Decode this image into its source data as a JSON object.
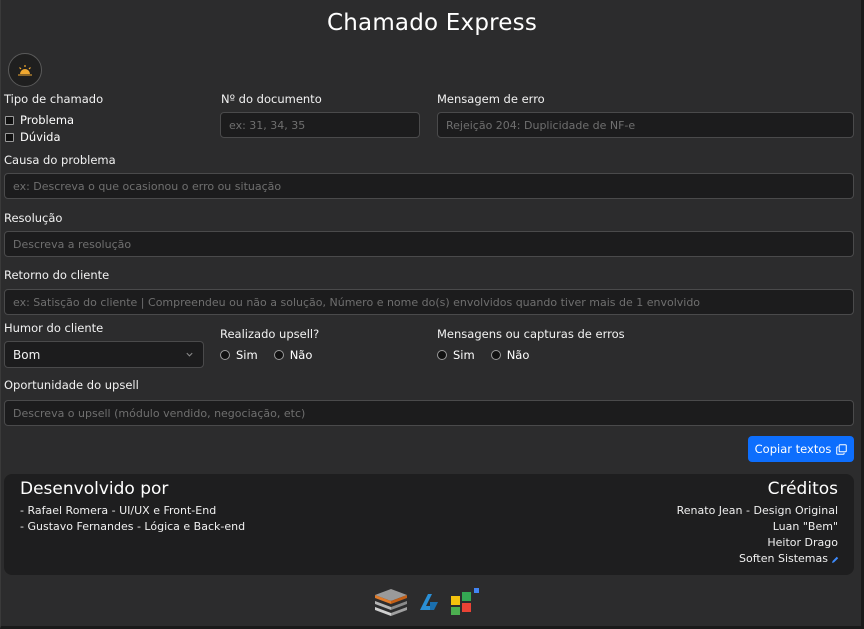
{
  "app": {
    "title": "Chamado Express"
  },
  "theme_toggle": {
    "icon": "sun-icon"
  },
  "tipo": {
    "label": "Tipo de chamado",
    "options": [
      "Problema",
      "Dúvida"
    ]
  },
  "documento": {
    "label": "Nº do documento",
    "placeholder": "ex: 31, 34, 35"
  },
  "erro": {
    "label": "Mensagem de erro",
    "placeholder": "Rejeição 204: Duplicidade de NF-e"
  },
  "causa": {
    "label": "Causa do problema",
    "placeholder": "ex: Descreva o que ocasionou o erro ou situação"
  },
  "resolucao": {
    "label": "Resolução",
    "placeholder": "Descreva a resolução"
  },
  "retorno": {
    "label": "Retorno do cliente",
    "placeholder": "ex: Satisção do cliente | Compreendeu ou não a solução, Número e nome do(s) envolvidos quando tiver mais de 1 envolvido"
  },
  "humor": {
    "label": "Humor do cliente",
    "value": "Bom"
  },
  "upsell_realizado": {
    "label": "Realizado upsell?",
    "options": [
      "Sim",
      "Não"
    ]
  },
  "capturas": {
    "label": "Mensagens ou capturas de erros",
    "options": [
      "Sim",
      "Não"
    ]
  },
  "oportunidade": {
    "label": "Oportunidade do upsell",
    "placeholder": "Descreva o upsell (módulo vendido, negociação, etc)"
  },
  "copy_button": {
    "label": "Copiar textos",
    "icon": "copy-icon",
    "color": "#0d6efd"
  },
  "footer": {
    "dev_title": "Desenvolvido por",
    "devs": [
      "- Rafael Romera - UI/UX e Front-End",
      "- Gustavo Fernandes - Lógica e Back-end"
    ],
    "credits_title": "Créditos",
    "credits": [
      "Renato Jean - Design Original",
      "Luan \"Bem\"",
      "Heitor Drago",
      "Soften Sistemas"
    ]
  },
  "logos": [
    "layers-logo",
    "arrow-logo",
    "squares-logo"
  ]
}
